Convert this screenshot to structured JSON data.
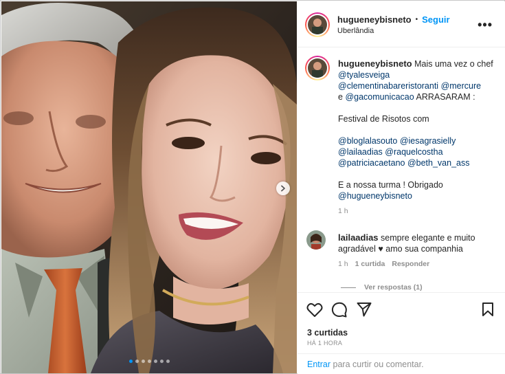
{
  "post": {
    "username": "hugueneybisneto",
    "separator": "•",
    "follow_label": "Seguir",
    "location": "Uberlândia",
    "more_label": "•••"
  },
  "caption": {
    "username": "hugueneybisneto",
    "text_1": "Mais uma vez o chef",
    "mention_1": "@tyalesveiga",
    "mention_2": "@clementinabareristoranti",
    "mention_3": "@mercure",
    "text_2": "e",
    "mention_4": "@gacomunicacao",
    "text_3": "ARRASARAM :",
    "text_4": "Festival de Risotos com",
    "mention_5": "@bloglalasouto",
    "mention_6": "@iesagrasielly",
    "mention_7": "@lailaadias",
    "mention_8": "@raquelcostha",
    "mention_9": "@patriciacaetano",
    "mention_10": "@beth_van_ass",
    "text_5": "E a nossa turma ! Obrigado",
    "mention_11": "@hugueneybisneto",
    "time": "1 h"
  },
  "comment": {
    "username": "lailaadias",
    "text_1": "sempre elegante e muito agradável",
    "heart": "♥",
    "text_2": "amo sua companhia",
    "time": "1 h",
    "likes": "1 curtida",
    "reply_label": "Responder",
    "view_replies": "Ver respostas (1)"
  },
  "footer": {
    "likes": "3 curtidas",
    "time_ago": "HÁ 1 HORA",
    "login_link": "Entrar",
    "login_text": "para curtir ou comentar."
  },
  "colors": {
    "accent": "#0095f6",
    "mention": "#00376b",
    "muted": "#8e8e8e"
  },
  "carousel": {
    "slide_count": 7,
    "active_slide": 1
  }
}
